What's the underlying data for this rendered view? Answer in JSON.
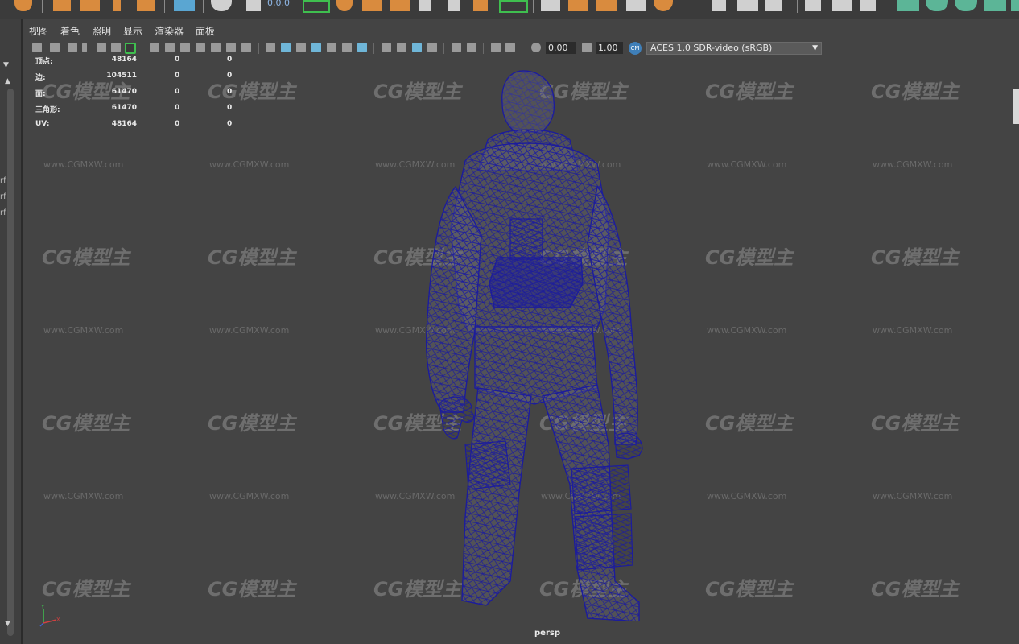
{
  "viewport_menu": {
    "items": [
      "视图",
      "着色",
      "照明",
      "显示",
      "渲染器",
      "面板"
    ]
  },
  "shelf": {
    "coords_text": "0,0,0"
  },
  "toolbar": {
    "exposure_value": "0.00",
    "gamma_value": "1.00",
    "colorspace_badge": "CM",
    "colorspace_label": "ACES 1.0 SDR-video (sRGB)"
  },
  "left_panel": {
    "truncated_labels": [
      "rf",
      "rf",
      "rf"
    ]
  },
  "hud_stats": {
    "rows": [
      {
        "label": "顶点:",
        "v1": "48164",
        "v2": "0",
        "v3": "0"
      },
      {
        "label": "边:",
        "v1": "104511",
        "v2": "0",
        "v3": "0"
      },
      {
        "label": "面:",
        "v1": "61470",
        "v2": "0",
        "v3": "0"
      },
      {
        "label": "三角形:",
        "v1": "61470",
        "v2": "0",
        "v3": "0"
      },
      {
        "label": "UV:",
        "v1": "48164",
        "v2": "0",
        "v3": "0"
      }
    ]
  },
  "watermark": {
    "logo_text": "CG模型主",
    "url_text": "www.CGMXW.com"
  },
  "camera_label": "persp",
  "axis_gizmo": {
    "y": "Y",
    "x": "X"
  },
  "colors": {
    "viewport_bg": "#444444",
    "wireframe": "#1c1c9c",
    "accent_orange": "#d98b3e",
    "accent_teal": "#5cb597",
    "accent_green": "#3fbf4f"
  }
}
